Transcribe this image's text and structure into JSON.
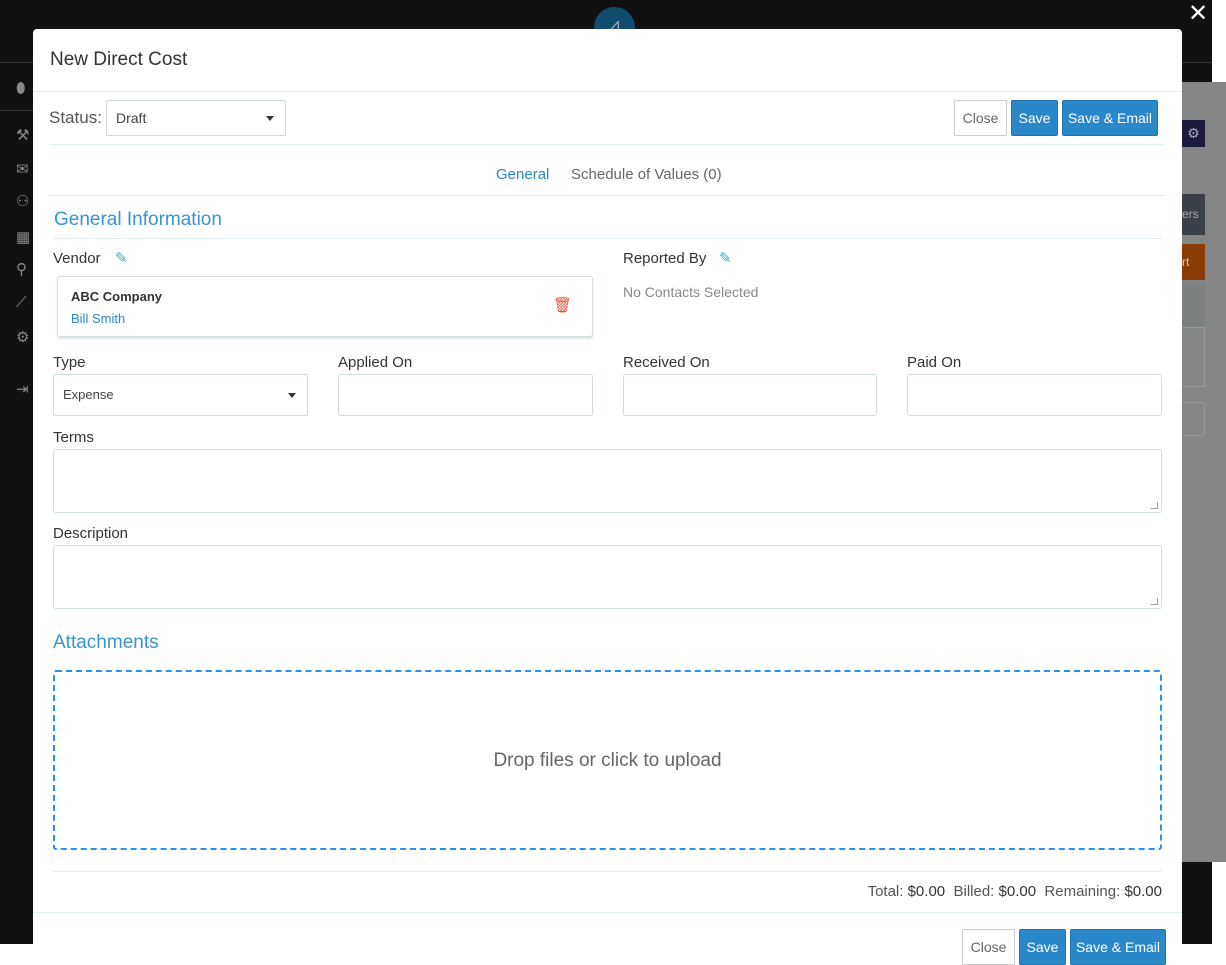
{
  "modal": {
    "title": "New Direct Cost",
    "status_label": "Status:",
    "status_value": "Draft",
    "buttons": {
      "close": "Close",
      "save": "Save",
      "save_email": "Save & Email"
    },
    "tabs": [
      {
        "label": "General",
        "active": true
      },
      {
        "label": "Schedule of Values (0)",
        "active": false
      }
    ],
    "general_heading": "General Information",
    "vendor": {
      "label": "Vendor",
      "company": "ABC Company",
      "contact": "Bill Smith"
    },
    "reported_by": {
      "label": "Reported By",
      "empty": "No Contacts Selected"
    },
    "fields": {
      "type": {
        "label": "Type",
        "value": "Expense"
      },
      "applied_on": {
        "label": "Applied On",
        "value": ""
      },
      "received_on": {
        "label": "Received On",
        "value": ""
      },
      "paid_on": {
        "label": "Paid On",
        "value": ""
      },
      "terms": {
        "label": "Terms",
        "value": ""
      },
      "description": {
        "label": "Description",
        "value": ""
      }
    },
    "attachments": {
      "heading": "Attachments",
      "drop_text": "Drop files or click to upload"
    },
    "totals": {
      "total_label": "Total:",
      "total": "$0.00",
      "billed_label": "Billed:",
      "billed": "$0.00",
      "remaining_label": "Remaining:",
      "remaining": "$0.00"
    }
  },
  "background": {
    "partial_button_1": "ers",
    "partial_button_2": "rt"
  },
  "colors": {
    "primary": "#2a87c8",
    "heading": "#3a95cc",
    "dropzone": "#2b8ff0",
    "danger": "#e0533b"
  }
}
